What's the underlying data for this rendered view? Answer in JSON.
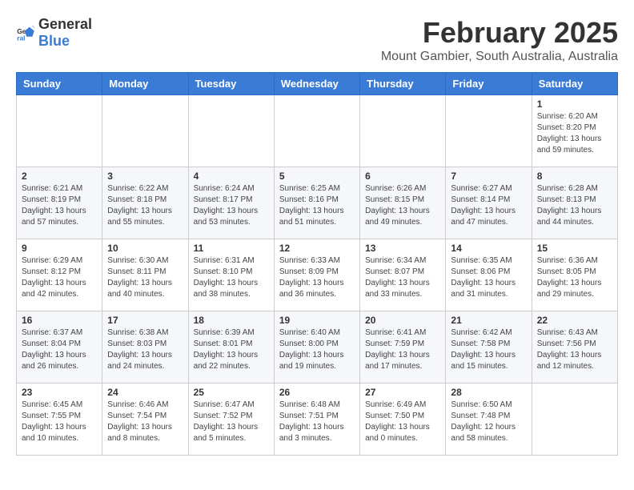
{
  "header": {
    "logo_general": "General",
    "logo_blue": "Blue",
    "month": "February 2025",
    "location": "Mount Gambier, South Australia, Australia"
  },
  "weekdays": [
    "Sunday",
    "Monday",
    "Tuesday",
    "Wednesday",
    "Thursday",
    "Friday",
    "Saturday"
  ],
  "weeks": [
    [
      {
        "day": "",
        "info": ""
      },
      {
        "day": "",
        "info": ""
      },
      {
        "day": "",
        "info": ""
      },
      {
        "day": "",
        "info": ""
      },
      {
        "day": "",
        "info": ""
      },
      {
        "day": "",
        "info": ""
      },
      {
        "day": "1",
        "info": "Sunrise: 6:20 AM\nSunset: 8:20 PM\nDaylight: 13 hours and 59 minutes."
      }
    ],
    [
      {
        "day": "2",
        "info": "Sunrise: 6:21 AM\nSunset: 8:19 PM\nDaylight: 13 hours and 57 minutes."
      },
      {
        "day": "3",
        "info": "Sunrise: 6:22 AM\nSunset: 8:18 PM\nDaylight: 13 hours and 55 minutes."
      },
      {
        "day": "4",
        "info": "Sunrise: 6:24 AM\nSunset: 8:17 PM\nDaylight: 13 hours and 53 minutes."
      },
      {
        "day": "5",
        "info": "Sunrise: 6:25 AM\nSunset: 8:16 PM\nDaylight: 13 hours and 51 minutes."
      },
      {
        "day": "6",
        "info": "Sunrise: 6:26 AM\nSunset: 8:15 PM\nDaylight: 13 hours and 49 minutes."
      },
      {
        "day": "7",
        "info": "Sunrise: 6:27 AM\nSunset: 8:14 PM\nDaylight: 13 hours and 47 minutes."
      },
      {
        "day": "8",
        "info": "Sunrise: 6:28 AM\nSunset: 8:13 PM\nDaylight: 13 hours and 44 minutes."
      }
    ],
    [
      {
        "day": "9",
        "info": "Sunrise: 6:29 AM\nSunset: 8:12 PM\nDaylight: 13 hours and 42 minutes."
      },
      {
        "day": "10",
        "info": "Sunrise: 6:30 AM\nSunset: 8:11 PM\nDaylight: 13 hours and 40 minutes."
      },
      {
        "day": "11",
        "info": "Sunrise: 6:31 AM\nSunset: 8:10 PM\nDaylight: 13 hours and 38 minutes."
      },
      {
        "day": "12",
        "info": "Sunrise: 6:33 AM\nSunset: 8:09 PM\nDaylight: 13 hours and 36 minutes."
      },
      {
        "day": "13",
        "info": "Sunrise: 6:34 AM\nSunset: 8:07 PM\nDaylight: 13 hours and 33 minutes."
      },
      {
        "day": "14",
        "info": "Sunrise: 6:35 AM\nSunset: 8:06 PM\nDaylight: 13 hours and 31 minutes."
      },
      {
        "day": "15",
        "info": "Sunrise: 6:36 AM\nSunset: 8:05 PM\nDaylight: 13 hours and 29 minutes."
      }
    ],
    [
      {
        "day": "16",
        "info": "Sunrise: 6:37 AM\nSunset: 8:04 PM\nDaylight: 13 hours and 26 minutes."
      },
      {
        "day": "17",
        "info": "Sunrise: 6:38 AM\nSunset: 8:03 PM\nDaylight: 13 hours and 24 minutes."
      },
      {
        "day": "18",
        "info": "Sunrise: 6:39 AM\nSunset: 8:01 PM\nDaylight: 13 hours and 22 minutes."
      },
      {
        "day": "19",
        "info": "Sunrise: 6:40 AM\nSunset: 8:00 PM\nDaylight: 13 hours and 19 minutes."
      },
      {
        "day": "20",
        "info": "Sunrise: 6:41 AM\nSunset: 7:59 PM\nDaylight: 13 hours and 17 minutes."
      },
      {
        "day": "21",
        "info": "Sunrise: 6:42 AM\nSunset: 7:58 PM\nDaylight: 13 hours and 15 minutes."
      },
      {
        "day": "22",
        "info": "Sunrise: 6:43 AM\nSunset: 7:56 PM\nDaylight: 13 hours and 12 minutes."
      }
    ],
    [
      {
        "day": "23",
        "info": "Sunrise: 6:45 AM\nSunset: 7:55 PM\nDaylight: 13 hours and 10 minutes."
      },
      {
        "day": "24",
        "info": "Sunrise: 6:46 AM\nSunset: 7:54 PM\nDaylight: 13 hours and 8 minutes."
      },
      {
        "day": "25",
        "info": "Sunrise: 6:47 AM\nSunset: 7:52 PM\nDaylight: 13 hours and 5 minutes."
      },
      {
        "day": "26",
        "info": "Sunrise: 6:48 AM\nSunset: 7:51 PM\nDaylight: 13 hours and 3 minutes."
      },
      {
        "day": "27",
        "info": "Sunrise: 6:49 AM\nSunset: 7:50 PM\nDaylight: 13 hours and 0 minutes."
      },
      {
        "day": "28",
        "info": "Sunrise: 6:50 AM\nSunset: 7:48 PM\nDaylight: 12 hours and 58 minutes."
      },
      {
        "day": "",
        "info": ""
      }
    ]
  ]
}
